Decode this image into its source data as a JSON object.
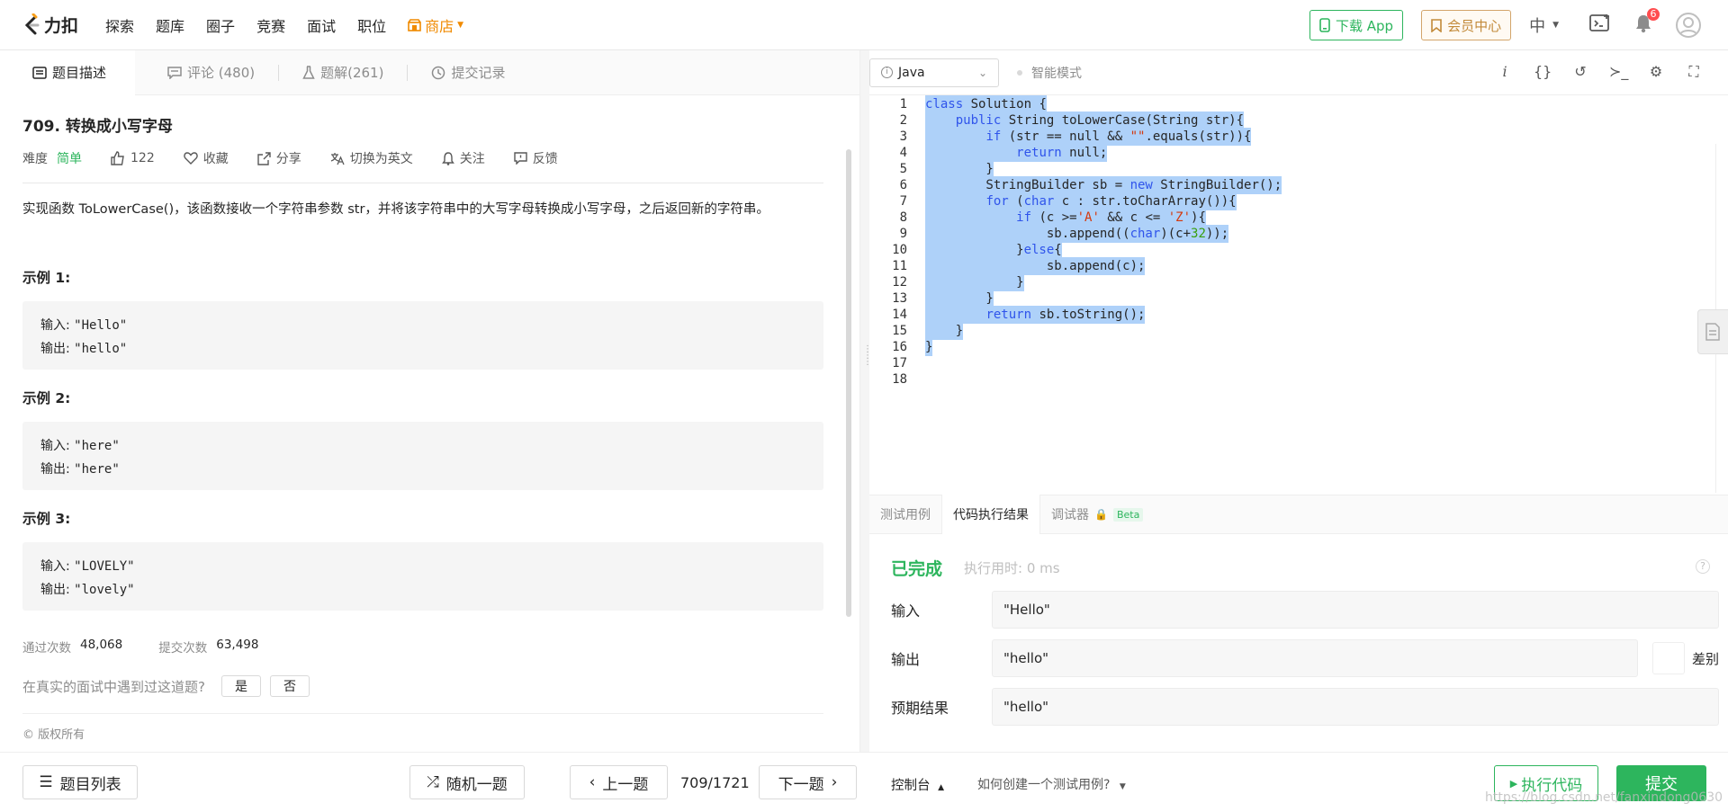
{
  "nav": {
    "logo_text": "力扣",
    "items": [
      "探索",
      "题库",
      "圈子",
      "竞赛",
      "面试",
      "职位"
    ],
    "shop": "商店",
    "download_app": "下载 App",
    "vip": "会员中心",
    "lang": "中",
    "notification_count": "6"
  },
  "left_tabs": {
    "description": "题目描述",
    "comments": "评论 (480)",
    "solutions": "题解(261)",
    "submissions": "提交记录"
  },
  "problem": {
    "title": "709. 转换成小写字母",
    "difficulty_label": "难度",
    "difficulty": "简单",
    "likes": "122",
    "favorite": "收藏",
    "share": "分享",
    "switch_lang": "切换为英文",
    "follow": "关注",
    "feedback": "反馈",
    "description": "实现函数 ToLowerCase()，该函数接收一个字符串参数 str，并将该字符串中的大写字母转换成小写字母，之后返回新的字符串。",
    "examples": [
      {
        "title": "示例 1:",
        "input_label": "输入: ",
        "input": "\"Hello\"",
        "output_label": "输出: ",
        "output": "\"hello\""
      },
      {
        "title": "示例 2:",
        "input_label": "输入: ",
        "input": "\"here\"",
        "output_label": "输出: ",
        "output": "\"here\""
      },
      {
        "title": "示例 3:",
        "input_label": "输入: ",
        "input": "\"LOVELY\"",
        "output_label": "输出: ",
        "output": "\"lovely\""
      }
    ],
    "accepted_label": "通过次数",
    "accepted": "48,068",
    "submitted_label": "提交次数",
    "submitted": "63,498",
    "interview_q": "在真实的面试中遇到过这道题?",
    "yes": "是",
    "no": "否",
    "copyright": "© 版权所有"
  },
  "editor": {
    "language": "Java",
    "smart_mode": "智能模式",
    "line_numbers": [
      "1",
      "2",
      "3",
      "4",
      "5",
      "6",
      "7",
      "8",
      "9",
      "10",
      "11",
      "12",
      "13",
      "14",
      "15",
      "16",
      "17",
      "18"
    ]
  },
  "bottom_tabs": {
    "testcase": "测试用例",
    "result": "代码执行结果",
    "debugger": "调试器",
    "beta": "Beta"
  },
  "result": {
    "status": "已完成",
    "exec_time": "执行用时: 0 ms",
    "input_label": "输入",
    "input": "\"Hello\"",
    "output_label": "输出",
    "output": "\"hello\"",
    "diff": "差别",
    "expected_label": "预期结果",
    "expected": "\"hello\""
  },
  "footer": {
    "problem_list": "题目列表",
    "random": "随机一题",
    "prev": "上一题",
    "pager": "709/1721",
    "next": "下一题",
    "console": "控制台",
    "howto": "如何创建一个测试用例?",
    "run": "执行代码",
    "submit": "提交",
    "watermark": "https://blog.csdn.net/fanxindong0630"
  },
  "colors": {
    "accent_green": "#2db55d",
    "shop_orange": "#f08a00",
    "selection": "#aed1f9"
  }
}
